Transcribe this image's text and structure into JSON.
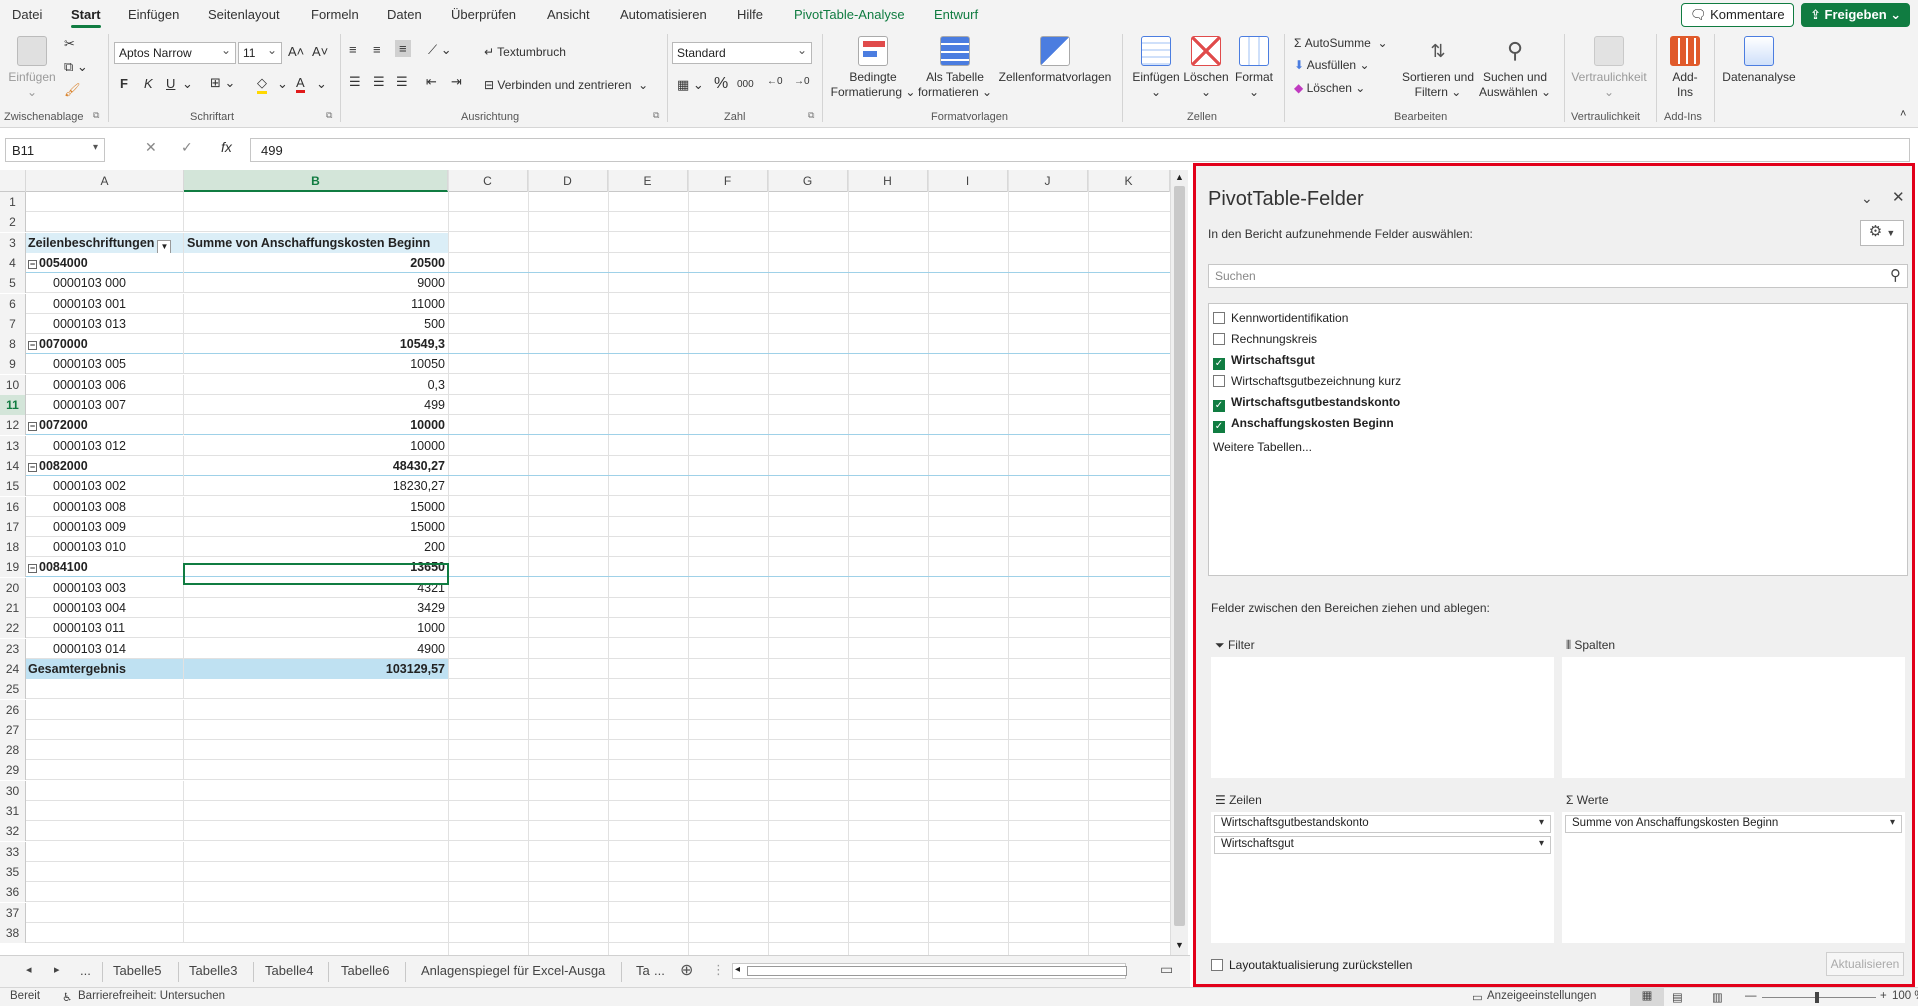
{
  "ribbon_tabs": [
    "Datei",
    "Start",
    "Einfügen",
    "Seitenlayout",
    "Formeln",
    "Daten",
    "Überprüfen",
    "Ansicht",
    "Automatisieren",
    "Hilfe",
    "PivotTable-Analyse",
    "Entwurf"
  ],
  "top_buttons": {
    "comments": "Kommentare",
    "share": "Freigeben"
  },
  "ribbon": {
    "clipboard": {
      "paste": "Einfügen",
      "group": "Zwischenablage"
    },
    "font": {
      "name": "Aptos Narrow",
      "size": "11",
      "bold": "F",
      "italic": "K",
      "underline": "U",
      "group": "Schriftart"
    },
    "alignment": {
      "wrap": "Textumbruch",
      "merge": "Verbinden und zentrieren",
      "group": "Ausrichtung"
    },
    "number": {
      "format": "Standard",
      "percent": "%",
      "thousands": "000",
      "group": "Zahl"
    },
    "styles": {
      "conditional": [
        "Bedingte",
        "Formatierung ⌄"
      ],
      "as_table": [
        "Als Tabelle",
        "formatieren ⌄"
      ],
      "cell_styles": "Zellenformatvorlagen",
      "group": "Formatvorlagen"
    },
    "cells": {
      "insert": "Einfügen",
      "delete": "Löschen",
      "format": "Format",
      "group": "Zellen"
    },
    "editing": {
      "autosum": "AutoSumme",
      "fill": "Ausfüllen",
      "clear": "Löschen",
      "sort": [
        "Sortieren und",
        "Filtern ⌄"
      ],
      "find": [
        "Suchen und",
        "Auswählen ⌄"
      ],
      "group": "Bearbeiten"
    },
    "sensitivity": {
      "label": "Vertraulichkeit",
      "group": "Vertraulichkeit"
    },
    "addins": {
      "label": [
        "Add-",
        "Ins"
      ],
      "group": "Add-Ins"
    },
    "analysis": {
      "label": "Datenanalyse"
    }
  },
  "formula_bar": {
    "name_box": "B11",
    "fx": "fx",
    "value": "499"
  },
  "columns": [
    "A",
    "B",
    "C",
    "D",
    "E",
    "F",
    "G",
    "H",
    "I",
    "J",
    "K"
  ],
  "rows": [
    {
      "n": "1",
      "a": "",
      "b": "",
      "type": "blank"
    },
    {
      "n": "2",
      "a": "",
      "b": "",
      "type": "blank"
    },
    {
      "n": "3",
      "a": "Zeilenbeschriftungen",
      "b": "Summe von Anschaffungskosten Beginn",
      "type": "hdr"
    },
    {
      "n": "4",
      "a": "0054000",
      "b": "20500",
      "type": "grp"
    },
    {
      "n": "5",
      "a": "0000103 000",
      "b": "9000",
      "type": "item"
    },
    {
      "n": "6",
      "a": "0000103 001",
      "b": "11000",
      "type": "item"
    },
    {
      "n": "7",
      "a": "0000103 013",
      "b": "500",
      "type": "item"
    },
    {
      "n": "8",
      "a": "0070000",
      "b": "10549,3",
      "type": "grp"
    },
    {
      "n": "9",
      "a": "0000103 005",
      "b": "10050",
      "type": "item"
    },
    {
      "n": "10",
      "a": "0000103 006",
      "b": "0,3",
      "type": "item"
    },
    {
      "n": "11",
      "a": "0000103 007",
      "b": "499",
      "type": "item"
    },
    {
      "n": "12",
      "a": "0072000",
      "b": "10000",
      "type": "grp"
    },
    {
      "n": "13",
      "a": "0000103 012",
      "b": "10000",
      "type": "item"
    },
    {
      "n": "14",
      "a": "0082000",
      "b": "48430,27",
      "type": "grp"
    },
    {
      "n": "15",
      "a": "0000103 002",
      "b": "18230,27",
      "type": "item"
    },
    {
      "n": "16",
      "a": "0000103 008",
      "b": "15000",
      "type": "item"
    },
    {
      "n": "17",
      "a": "0000103 009",
      "b": "15000",
      "type": "item"
    },
    {
      "n": "18",
      "a": "0000103 010",
      "b": "200",
      "type": "item"
    },
    {
      "n": "19",
      "a": "0084100",
      "b": "13650",
      "type": "grp"
    },
    {
      "n": "20",
      "a": "0000103 003",
      "b": "4321",
      "type": "item"
    },
    {
      "n": "21",
      "a": "0000103 004",
      "b": "3429",
      "type": "item"
    },
    {
      "n": "22",
      "a": "0000103 011",
      "b": "1000",
      "type": "item"
    },
    {
      "n": "23",
      "a": "0000103 014",
      "b": "4900",
      "type": "item"
    },
    {
      "n": "24",
      "a": "Gesamtergebnis",
      "b": "103129,57",
      "type": "total"
    },
    {
      "n": "25",
      "a": "",
      "b": "",
      "type": "blank"
    },
    {
      "n": "26",
      "a": "",
      "b": "",
      "type": "blank"
    },
    {
      "n": "27",
      "a": "",
      "b": "",
      "type": "blank"
    },
    {
      "n": "28",
      "a": "",
      "b": "",
      "type": "blank"
    },
    {
      "n": "29",
      "a": "",
      "b": "",
      "type": "blank"
    },
    {
      "n": "30",
      "a": "",
      "b": "",
      "type": "blank"
    },
    {
      "n": "31",
      "a": "",
      "b": "",
      "type": "blank"
    },
    {
      "n": "32",
      "a": "",
      "b": "",
      "type": "blank"
    },
    {
      "n": "33",
      "a": "",
      "b": "",
      "type": "blank"
    },
    {
      "n": "35",
      "a": "",
      "b": "",
      "type": "blank"
    },
    {
      "n": "36",
      "a": "",
      "b": "",
      "type": "blank"
    },
    {
      "n": "37",
      "a": "",
      "b": "",
      "type": "blank"
    },
    {
      "n": "38",
      "a": "",
      "b": "",
      "type": "blank"
    }
  ],
  "selected_row": "11",
  "sheet_tabs": [
    "Tabelle5",
    "Tabelle3",
    "Tabelle4",
    "Tabelle6",
    "Anlagenspiegel für Excel-Ausga",
    "Ta"
  ],
  "sheet_nav": {
    "more_left": "...",
    "more_right": "..."
  },
  "status": {
    "ready": "Bereit",
    "accessibility": "Barrierefreiheit: Untersuchen",
    "display_settings": "Anzeigeeinstellungen",
    "zoom": "100 %"
  },
  "pivot": {
    "title": "PivotTable-Felder",
    "subtitle": "In den Bericht aufzunehmende Felder auswählen:",
    "search_placeholder": "Suchen",
    "fields": [
      {
        "label": "Kennwortidentifikation",
        "checked": false
      },
      {
        "label": "Rechnungskreis",
        "checked": false
      },
      {
        "label": "Wirtschaftsgut",
        "checked": true
      },
      {
        "label": "Wirtschaftsgutbezeichnung kurz",
        "checked": false
      },
      {
        "label": "Wirtschaftsgutbestandskonto",
        "checked": true
      },
      {
        "label": "Anschaffungskosten Beginn",
        "checked": true
      }
    ],
    "more_tables": "Weitere Tabellen...",
    "drag_hint": "Felder zwischen den Bereichen ziehen und ablegen:",
    "areas": {
      "filter": "Filter",
      "columns": "Spalten",
      "rows": "Zeilen",
      "values": "Werte"
    },
    "row_fields": [
      "Wirtschaftsgutbestandskonto",
      "Wirtschaftsgut"
    ],
    "value_fields": [
      "Summe von Anschaffungskosten Beginn"
    ],
    "defer_label": "Layoutaktualisierung zurückstellen",
    "update_button": "Aktualisieren"
  }
}
